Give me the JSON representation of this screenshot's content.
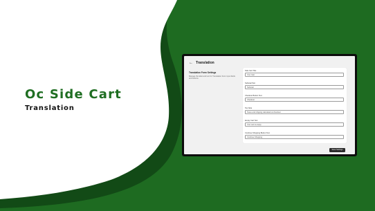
{
  "hero": {
    "title": "Oc Side Cart",
    "subtitle": "Translation"
  },
  "colors": {
    "brand_green": "#1e6b21",
    "dark_green": "#124a16",
    "button": "#2b2b2b"
  },
  "app": {
    "back_icon": "arrow-left-icon",
    "title": "Translation",
    "section": {
      "title": "Translation Form Settings",
      "description": "Manage the label and text for Translation Form input fields and buttons."
    },
    "fields": [
      {
        "label": "Side Cart Title",
        "value": "Your Cart"
      },
      {
        "label": "Subtotal Text",
        "value": "Subtotal"
      },
      {
        "label": "Checkout Button Text",
        "value": "Checkout"
      },
      {
        "label": "Tax Note",
        "value": "Taxes and shipping calculated at checkout"
      },
      {
        "label": "Empty Cart Text",
        "value": "Your cart is empty"
      },
      {
        "label": "Continue Shopping Button Text",
        "value": "Continue Shopping"
      }
    ],
    "save_label": "Save Settings"
  }
}
